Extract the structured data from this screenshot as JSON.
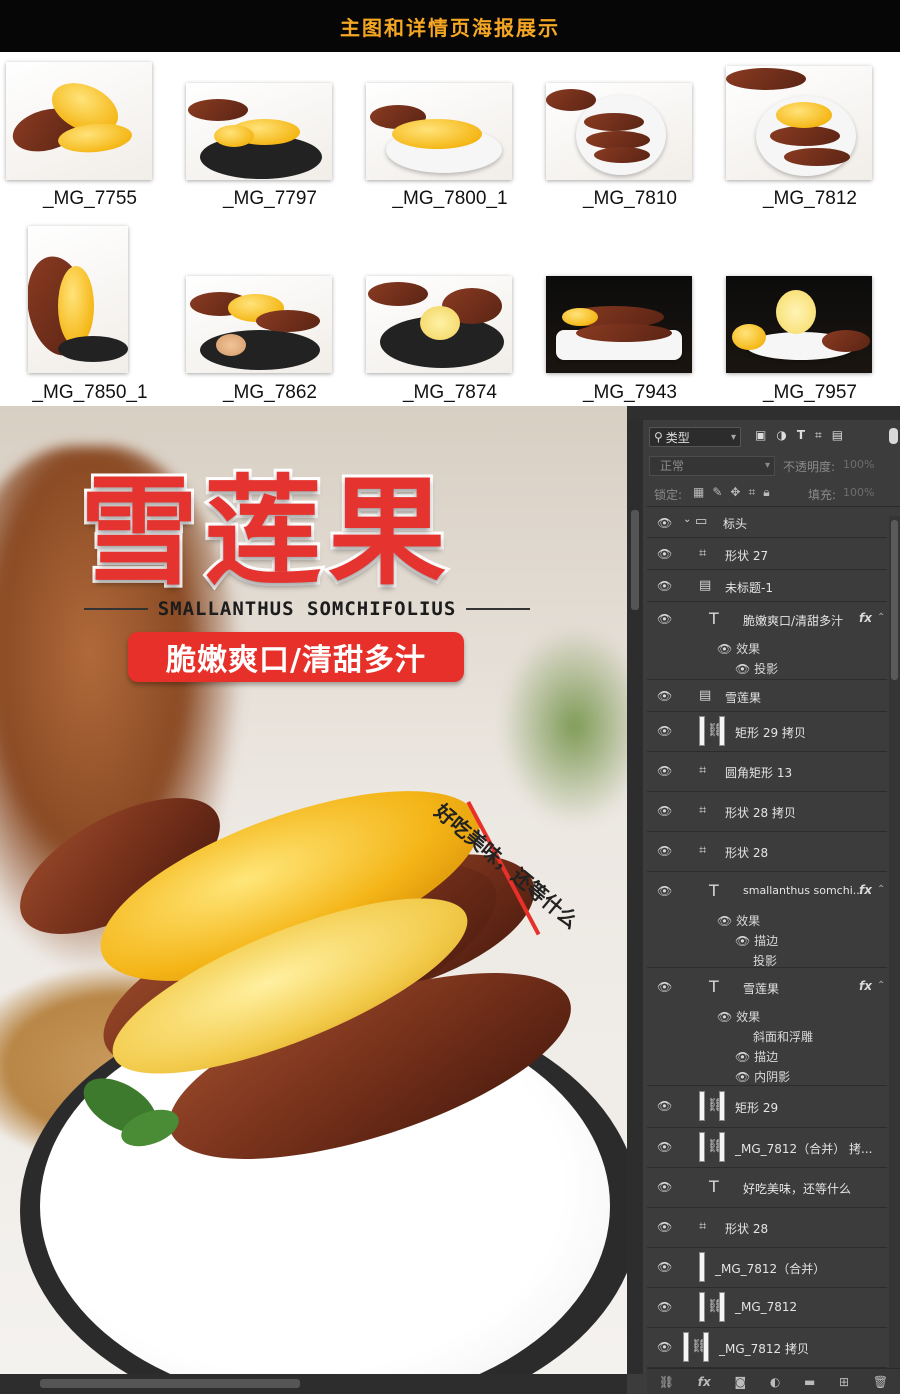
{
  "banner": {
    "title": "主图和详情页海报展示"
  },
  "thumbnails": [
    {
      "caption": "_MG_7755"
    },
    {
      "caption": "_MG_7797"
    },
    {
      "caption": "_MG_7800_1"
    },
    {
      "caption": "_MG_7810"
    },
    {
      "caption": "_MG_7812"
    },
    {
      "caption": "_MG_7850_1"
    },
    {
      "caption": "_MG_7862"
    },
    {
      "caption": "_MG_7874"
    },
    {
      "caption": "_MG_7943"
    },
    {
      "caption": "_MG_7957"
    }
  ],
  "poster": {
    "title": "雪莲果",
    "subtitle": "SMALLANTHUS SOMCHIFOLIUS",
    "pill": "脆嫩爽口/清甜多汁",
    "arc_text": "好吃美味，还等什么"
  },
  "layers_panel": {
    "filter_label": "类型",
    "blend_mode": "正常",
    "opacity_label": "不透明度:",
    "opacity_value": "100%",
    "lock_label": "锁定:",
    "fill_label": "填充:",
    "fill_value": "100%",
    "layers": [
      {
        "name": "标头",
        "kind": "folder"
      },
      {
        "name": "形状 27",
        "kind": "shape"
      },
      {
        "name": "未标题-1",
        "kind": "smart"
      },
      {
        "name": "脆嫩爽口/清甜多汁",
        "kind": "text",
        "fx": "fx",
        "effects": [
          "效果",
          "投影"
        ]
      },
      {
        "name": "雪莲果",
        "kind": "smart"
      },
      {
        "name": "矩形 29 拷贝",
        "kind": "linked"
      },
      {
        "name": "圆角矩形 13",
        "kind": "shape"
      },
      {
        "name": "形状 28 拷贝",
        "kind": "shape"
      },
      {
        "name": "形状 28",
        "kind": "shape"
      },
      {
        "name": "smallanthus somchi...",
        "kind": "text",
        "fx": "fx",
        "effects": [
          "效果",
          "描边",
          "投影"
        ]
      },
      {
        "name": "雪莲果",
        "kind": "text",
        "fx": "fx",
        "effects": [
          "效果",
          "斜面和浮雕",
          "描边",
          "内阴影"
        ]
      },
      {
        "name": "矩形 29",
        "kind": "linked"
      },
      {
        "name": "_MG_7812（合并） 拷...",
        "kind": "linked"
      },
      {
        "name": "好吃美味，还等什么",
        "kind": "text"
      },
      {
        "name": "形状 28",
        "kind": "shape"
      },
      {
        "name": "_MG_7812（合并）",
        "kind": "pixel"
      },
      {
        "name": "_MG_7812",
        "kind": "linked"
      },
      {
        "name": "_MG_7812 拷贝",
        "kind": "linked"
      }
    ]
  },
  "icons": {
    "eye": "eye-icon",
    "folder": "folder-icon",
    "text": "text-layer-icon",
    "shape": "shape-layer-icon",
    "smart": "smart-object-icon",
    "link": "link-icon"
  },
  "colors": {
    "banner_text": "#f5a623",
    "title_red": "#e5342f",
    "panel_bg": "#3c3c3c"
  }
}
